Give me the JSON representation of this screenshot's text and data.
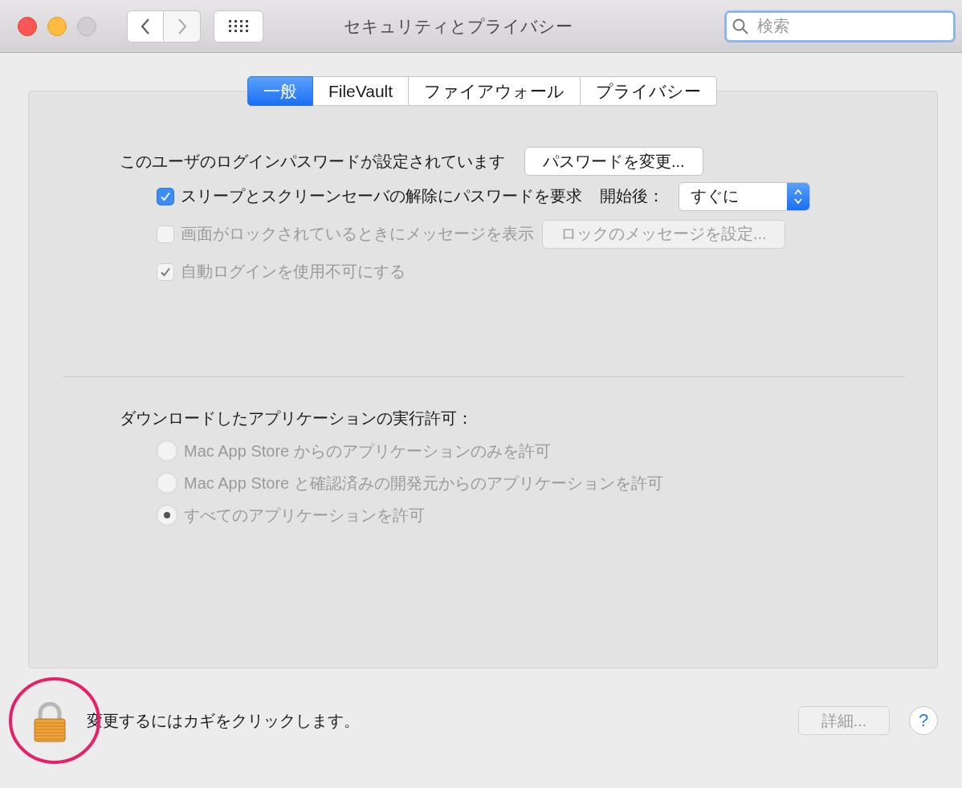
{
  "window": {
    "title": "セキュリティとプライバシー"
  },
  "toolbar": {
    "search": {
      "placeholder": "検索"
    }
  },
  "tabs": [
    {
      "label": "一般",
      "selected": true
    },
    {
      "label": "FileVault",
      "selected": false
    },
    {
      "label": "ファイアウォール",
      "selected": false
    },
    {
      "label": "プライバシー",
      "selected": false
    }
  ],
  "general": {
    "password_status": "このユーザのログインパスワードが設定されています",
    "change_password_button": "パスワードを変更...",
    "options": [
      {
        "kind": "popup",
        "label": "スリープとスクリーンセーバの解除にパスワードを要求",
        "checked": true,
        "disabled": false,
        "popup_label": "開始後：",
        "popup_value": "すぐに"
      },
      {
        "kind": "button",
        "label": "画面がロックされているときにメッセージを表示",
        "checked": false,
        "disabled": true,
        "button_label": "ロックのメッセージを設定...",
        "button_disabled": true
      },
      {
        "kind": "plain",
        "label": "自動ログインを使用不可にする",
        "checked": true,
        "disabled": true
      }
    ]
  },
  "downloads": {
    "heading": "ダウンロードしたアプリケーションの実行許可：",
    "radios": [
      {
        "label": "Mac App Store からのアプリケーションのみを許可",
        "selected": false,
        "disabled": true
      },
      {
        "label": "Mac App Store と確認済みの開発元からのアプリケーションを許可",
        "selected": false,
        "disabled": true
      },
      {
        "label": "すべてのアプリケーションを許可",
        "selected": true,
        "disabled": true
      }
    ]
  },
  "footer": {
    "lock_text": "変更するにはカギをクリックします。",
    "advanced_button": {
      "label": "詳細...",
      "disabled": true
    },
    "help_button": "?"
  }
}
